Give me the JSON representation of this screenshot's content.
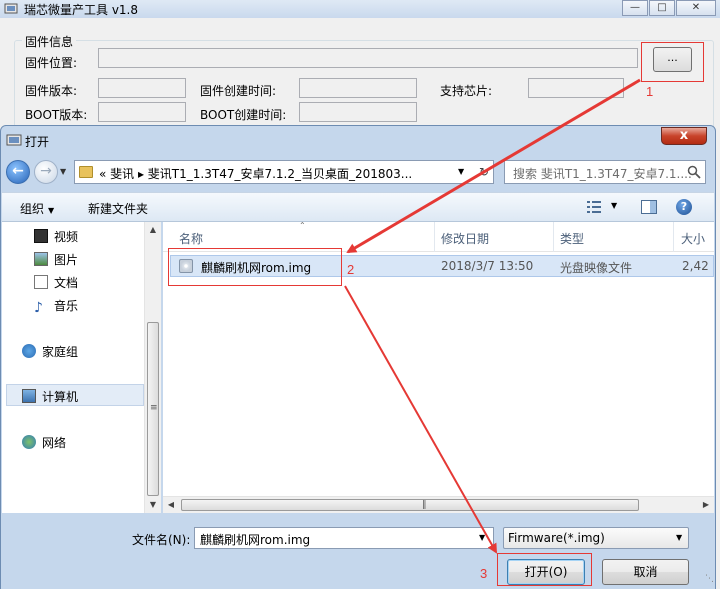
{
  "bg_app": {
    "title": "瑞芯微量产工具 v1.8",
    "window_buttons": [
      "—",
      "□",
      "✕"
    ],
    "group_title": "固件信息",
    "firmware_location_label": "固件位置:",
    "browse_label": "...",
    "firmware_version_label": "固件版本:",
    "firmware_created_label": "固件创建时间:",
    "supported_chip_label": "支持芯片:",
    "boot_version_label": "BOOT版本:",
    "boot_created_label": "BOOT创建时间:"
  },
  "dialog": {
    "title": "打开",
    "close_label": "x",
    "address_path": "« 斐讯 ▸ 斐讯T1_1.3T47_安卓7.1.2_当贝桌面_201803...",
    "search_placeholder": "搜索 斐讯T1_1.3T47_安卓7.1....",
    "toolbar": {
      "organize": "组织",
      "new_folder": "新建文件夹"
    },
    "nav_items": [
      "视频",
      "图片",
      "文档",
      "音乐",
      "家庭组",
      "计算机",
      "网络"
    ],
    "columns": [
      "名称",
      "修改日期",
      "类型",
      "大小"
    ],
    "files": [
      {
        "name": "麒麟刷机网rom.img",
        "modified": "2018/3/7 13:50",
        "type": "光盘映像文件",
        "size": "2,42"
      }
    ],
    "filename_label": "文件名(N):",
    "filename_value": "麒麟刷机网rom.img",
    "filter_value": "Firmware(*.img)",
    "open_button": "打开(O)",
    "cancel_button": "取消"
  },
  "annotations": [
    "1",
    "2",
    "3"
  ],
  "colors": {
    "annotation": "#e53935",
    "selection": "#d8e6f7",
    "dialog_frame": "#c5d7ec"
  }
}
